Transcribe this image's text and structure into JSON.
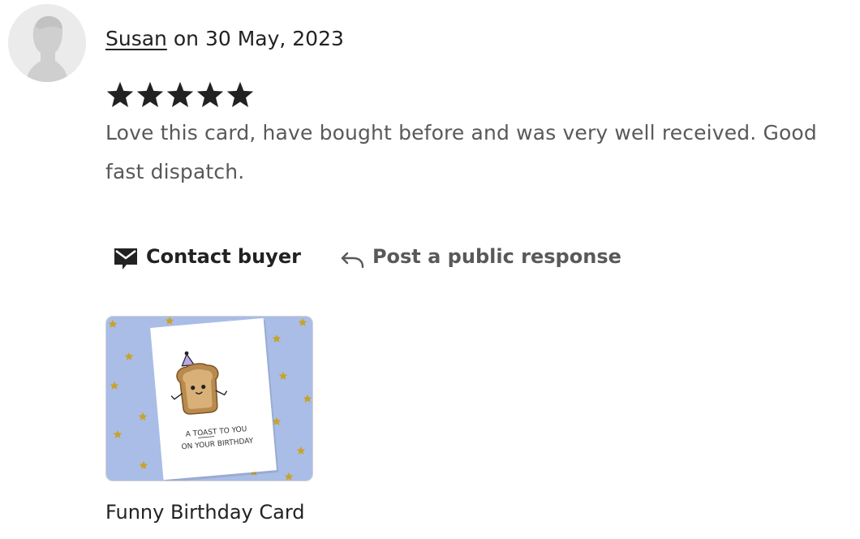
{
  "review": {
    "reviewer_name": "Susan",
    "date_text": " on 30 May, 2023",
    "rating": 5,
    "rating_max": 5,
    "text": "Love this card, have bought before and was very well received. Good fast dispatch."
  },
  "actions": {
    "contact_label": "Contact buyer",
    "contact_icon": "envelope-icon",
    "respond_label": "Post a public response",
    "respond_icon": "reply-arrow-icon"
  },
  "listing": {
    "title": "Funny Birthday Card",
    "card_text_line1": "A TOAST TO YOU",
    "card_text_line2": "ON YOUR BIRTHDAY"
  },
  "colors": {
    "text_primary": "#222222",
    "text_secondary": "#595959",
    "star": "#222222",
    "thumb_background": "#a9bde6",
    "confetti": "#c9a227"
  }
}
